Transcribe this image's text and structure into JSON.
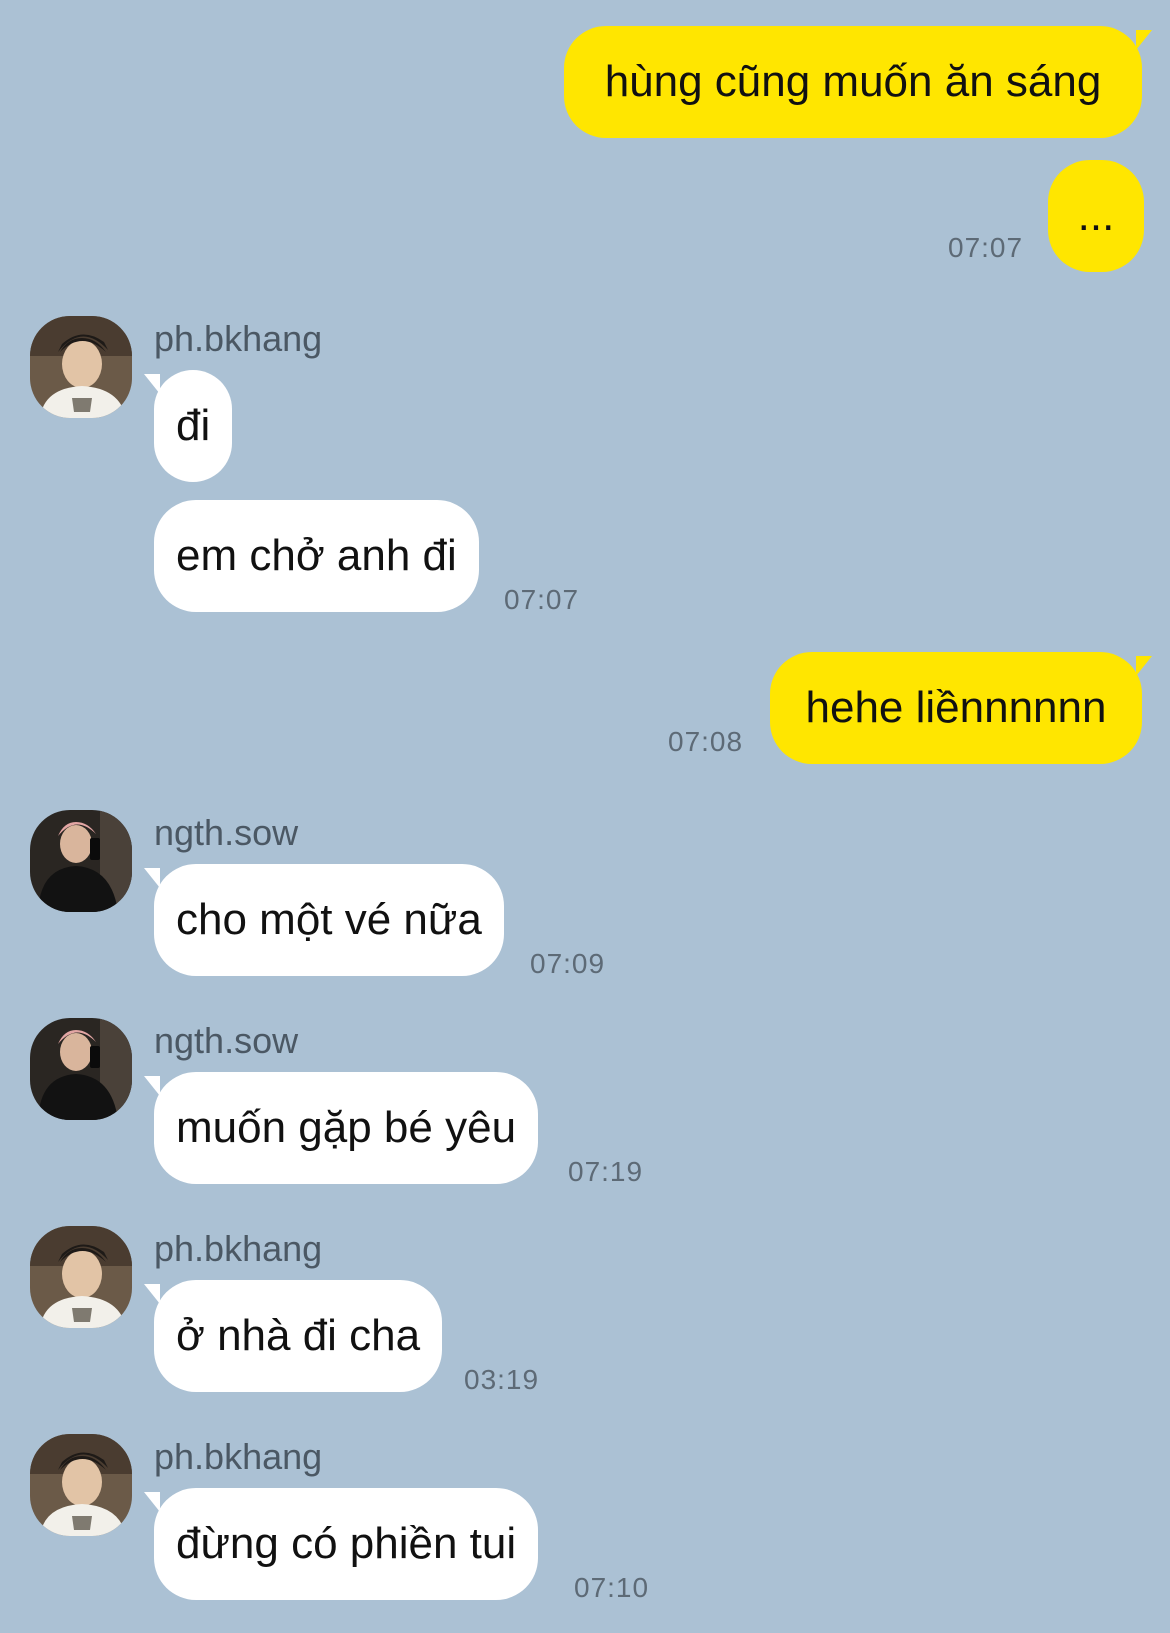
{
  "colors": {
    "background": "#abc1d4",
    "outgoing_bubble": "#ffe600",
    "incoming_bubble": "#ffffff",
    "timestamp": "#5d6a76",
    "sender_name": "#4b5864"
  },
  "messages": [
    {
      "direction": "outgoing",
      "text": "hùng cũng muốn ăn sáng"
    },
    {
      "direction": "outgoing",
      "text": "...",
      "time": "07:07"
    },
    {
      "direction": "incoming",
      "sender": "ph.bkhang",
      "avatar": "avatar-photo-khang",
      "text": "đi"
    },
    {
      "direction": "incoming",
      "text": "em chở anh đi",
      "time": "07:07"
    },
    {
      "direction": "outgoing",
      "text": "hehe liềnnnnnn",
      "time": "07:08"
    },
    {
      "direction": "incoming",
      "sender": "ngth.sow",
      "avatar": "avatar-photo-sow",
      "text": "cho một vé nữa",
      "time": "07:09"
    },
    {
      "direction": "incoming",
      "sender": "ngth.sow",
      "avatar": "avatar-photo-sow",
      "text": "muốn gặp bé yêu",
      "time": "07:19"
    },
    {
      "direction": "incoming",
      "sender": "ph.bkhang",
      "avatar": "avatar-photo-khang",
      "text": "ở nhà đi cha",
      "time": "03:19"
    },
    {
      "direction": "incoming",
      "sender": "ph.bkhang",
      "avatar": "avatar-photo-khang",
      "text": "đừng có phiền tui",
      "time": "07:10"
    }
  ]
}
